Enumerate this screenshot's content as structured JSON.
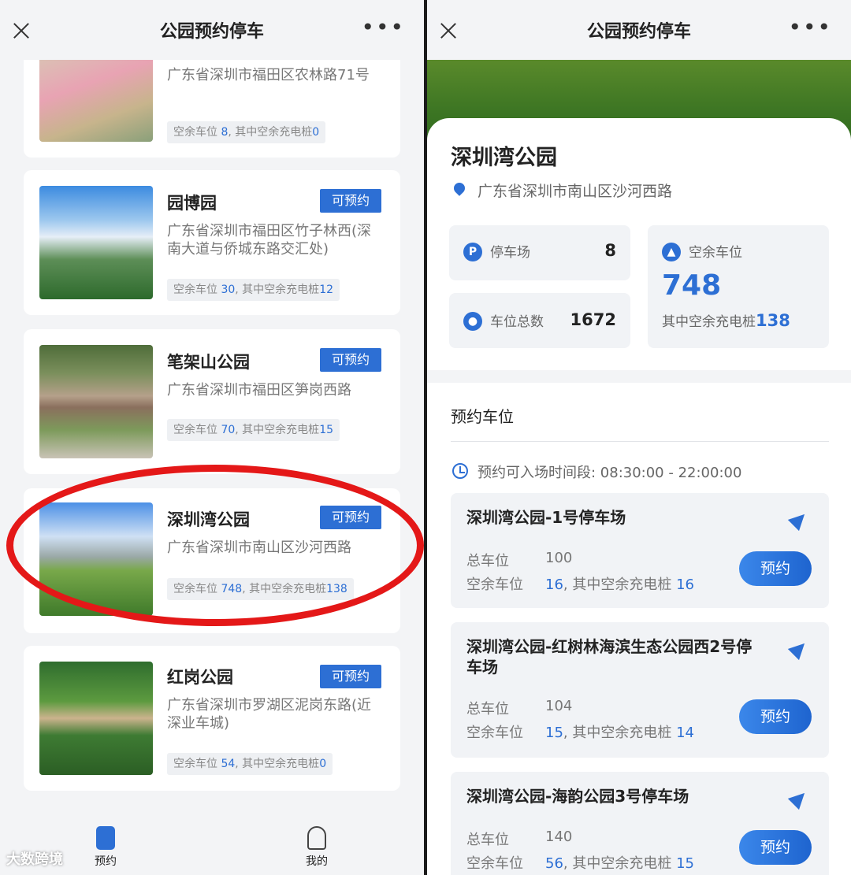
{
  "left": {
    "header": {
      "title": "公园预约停车"
    },
    "parks": [
      {
        "name": "",
        "badge": "",
        "address": "广东省深圳市福田区农林路71号",
        "spaces_label": "空余车位",
        "spaces": "8",
        "charge_label": ", 其中空余充电桩",
        "charge": "0"
      },
      {
        "name": "园博园",
        "badge": "可预约",
        "address": "广东省深圳市福田区竹子林西(深南大道与侨城东路交汇处)",
        "spaces_label": "空余车位",
        "spaces": "30",
        "charge_label": ", 其中空余充电桩",
        "charge": "12"
      },
      {
        "name": "笔架山公园",
        "badge": "可预约",
        "address": "广东省深圳市福田区笋岗西路",
        "spaces_label": "空余车位",
        "spaces": "70",
        "charge_label": ", 其中空余充电桩",
        "charge": "15"
      },
      {
        "name": "深圳湾公园",
        "badge": "可预约",
        "address": "广东省深圳市南山区沙河西路",
        "spaces_label": "空余车位",
        "spaces": "748",
        "charge_label": ", 其中空余充电桩",
        "charge": "138"
      },
      {
        "name": "红岗公园",
        "badge": "可预约",
        "address": "广东省深圳市罗湖区泥岗东路(近深业车城)",
        "spaces_label": "空余车位",
        "spaces": "54",
        "charge_label": ", 其中空余充电桩",
        "charge": "0"
      }
    ],
    "tabs": {
      "book": "预约",
      "mine": "我的"
    },
    "watermark": "大数跨境"
  },
  "right": {
    "header": {
      "title": "公园预约停车"
    },
    "park": {
      "name": "深圳湾公园",
      "address": "广东省深圳市南山区沙河西路"
    },
    "stats": {
      "lots_label": "停车场",
      "lots": "8",
      "total_label": "车位总数",
      "total": "1672",
      "free_label": "空余车位",
      "free": "748",
      "charge_label": "其中空余充电桩",
      "charge": "138"
    },
    "section_title": "预约车位",
    "time_window": "预约可入场时间段:  08:30:00 - 22:00:00",
    "lots": [
      {
        "name": "深圳湾公园-1号停车场",
        "total_label": "总车位",
        "total": "100",
        "free_label": "空余车位",
        "free": "16",
        "charge_label": ", 其中空余充电桩 ",
        "charge": "16",
        "button": "预约"
      },
      {
        "name": "深圳湾公园-红树林海滨生态公园西2号停车场",
        "total_label": "总车位",
        "total": "104",
        "free_label": "空余车位",
        "free": "15",
        "charge_label": ", 其中空余充电桩 ",
        "charge": "14",
        "button": "预约"
      },
      {
        "name": "深圳湾公园-海韵公园3号停车场",
        "total_label": "总车位",
        "total": "140",
        "free_label": "空余车位",
        "free": "56",
        "charge_label": ", 其中空余充电桩 ",
        "charge": "15",
        "button": "预约"
      }
    ]
  },
  "colors": {
    "accent": "#2d6fd4",
    "highlight": "#e41818"
  }
}
